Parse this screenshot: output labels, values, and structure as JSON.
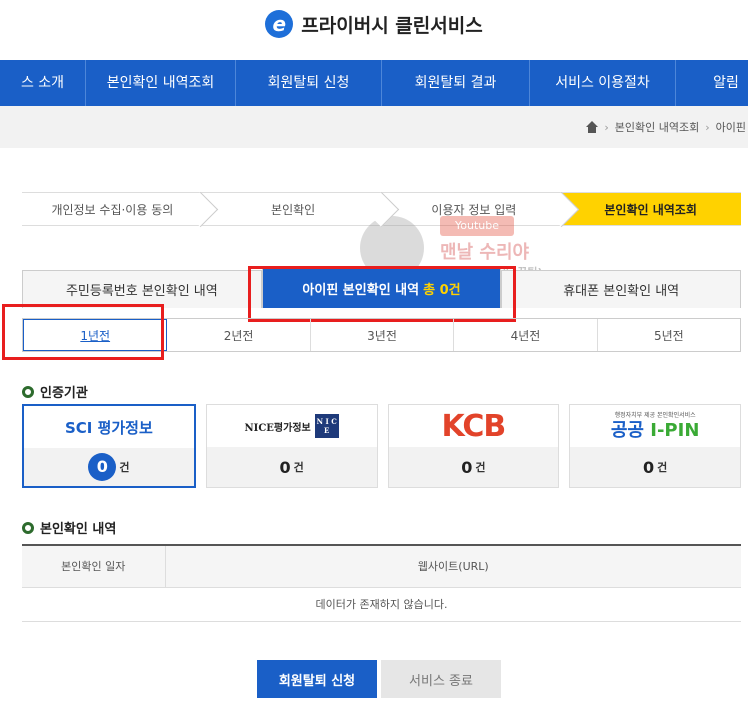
{
  "header": {
    "logo_letter": "e",
    "title": "프라이버시 클린서비스"
  },
  "nav": {
    "items": [
      "스 소개",
      "본인확인 내역조회",
      "회원탈퇴 신청",
      "회원탈퇴 결과",
      "서비스 이용절차",
      "알림"
    ]
  },
  "breadcrumb": {
    "items": [
      "본인확인 내역조회",
      "아이핀"
    ]
  },
  "steps": [
    "개인정보 수집·이용 동의",
    "본인확인",
    "이용자 정보 입력",
    "본인확인 내역조회"
  ],
  "watermark": {
    "badge": "Youtube",
    "line1": "맨날 수리야",
    "line2": "(PC 무료 수리, 꿀팁)"
  },
  "tabs": [
    {
      "label": "주민등록번호 본인확인 내역"
    },
    {
      "label": "아이핀 본인확인 내역",
      "count": "총 0건"
    },
    {
      "label": "휴대폰 본인확인 내역"
    }
  ],
  "years": [
    "1년전",
    "2년전",
    "3년전",
    "4년전",
    "5년전"
  ],
  "agencies_section": {
    "title": "인증기관"
  },
  "agencies": [
    {
      "name": "SCI 평가정보",
      "count": "0",
      "unit": "건"
    },
    {
      "name": "NICE평가정보",
      "count": "0",
      "unit": "건"
    },
    {
      "name": "KCB",
      "count": "0",
      "unit": "건"
    },
    {
      "name_small": "행정자치부 제공 본인확인서비스",
      "name_a": "공공",
      "name_b": "I-PIN",
      "count": "0",
      "unit": "건"
    }
  ],
  "history_section": {
    "title": "본인확인 내역"
  },
  "table": {
    "headers": [
      "본인확인 일자",
      "웹사이트(URL)"
    ],
    "empty": "데이터가 존재하지 않습니다."
  },
  "buttons": {
    "withdraw": "회원탈퇴 신청",
    "exit": "서비스 종료"
  },
  "colors": {
    "primary": "#1a5fc7",
    "accent": "#ffd200",
    "highlight": "#e81e1e",
    "kcb": "#e2432a"
  }
}
